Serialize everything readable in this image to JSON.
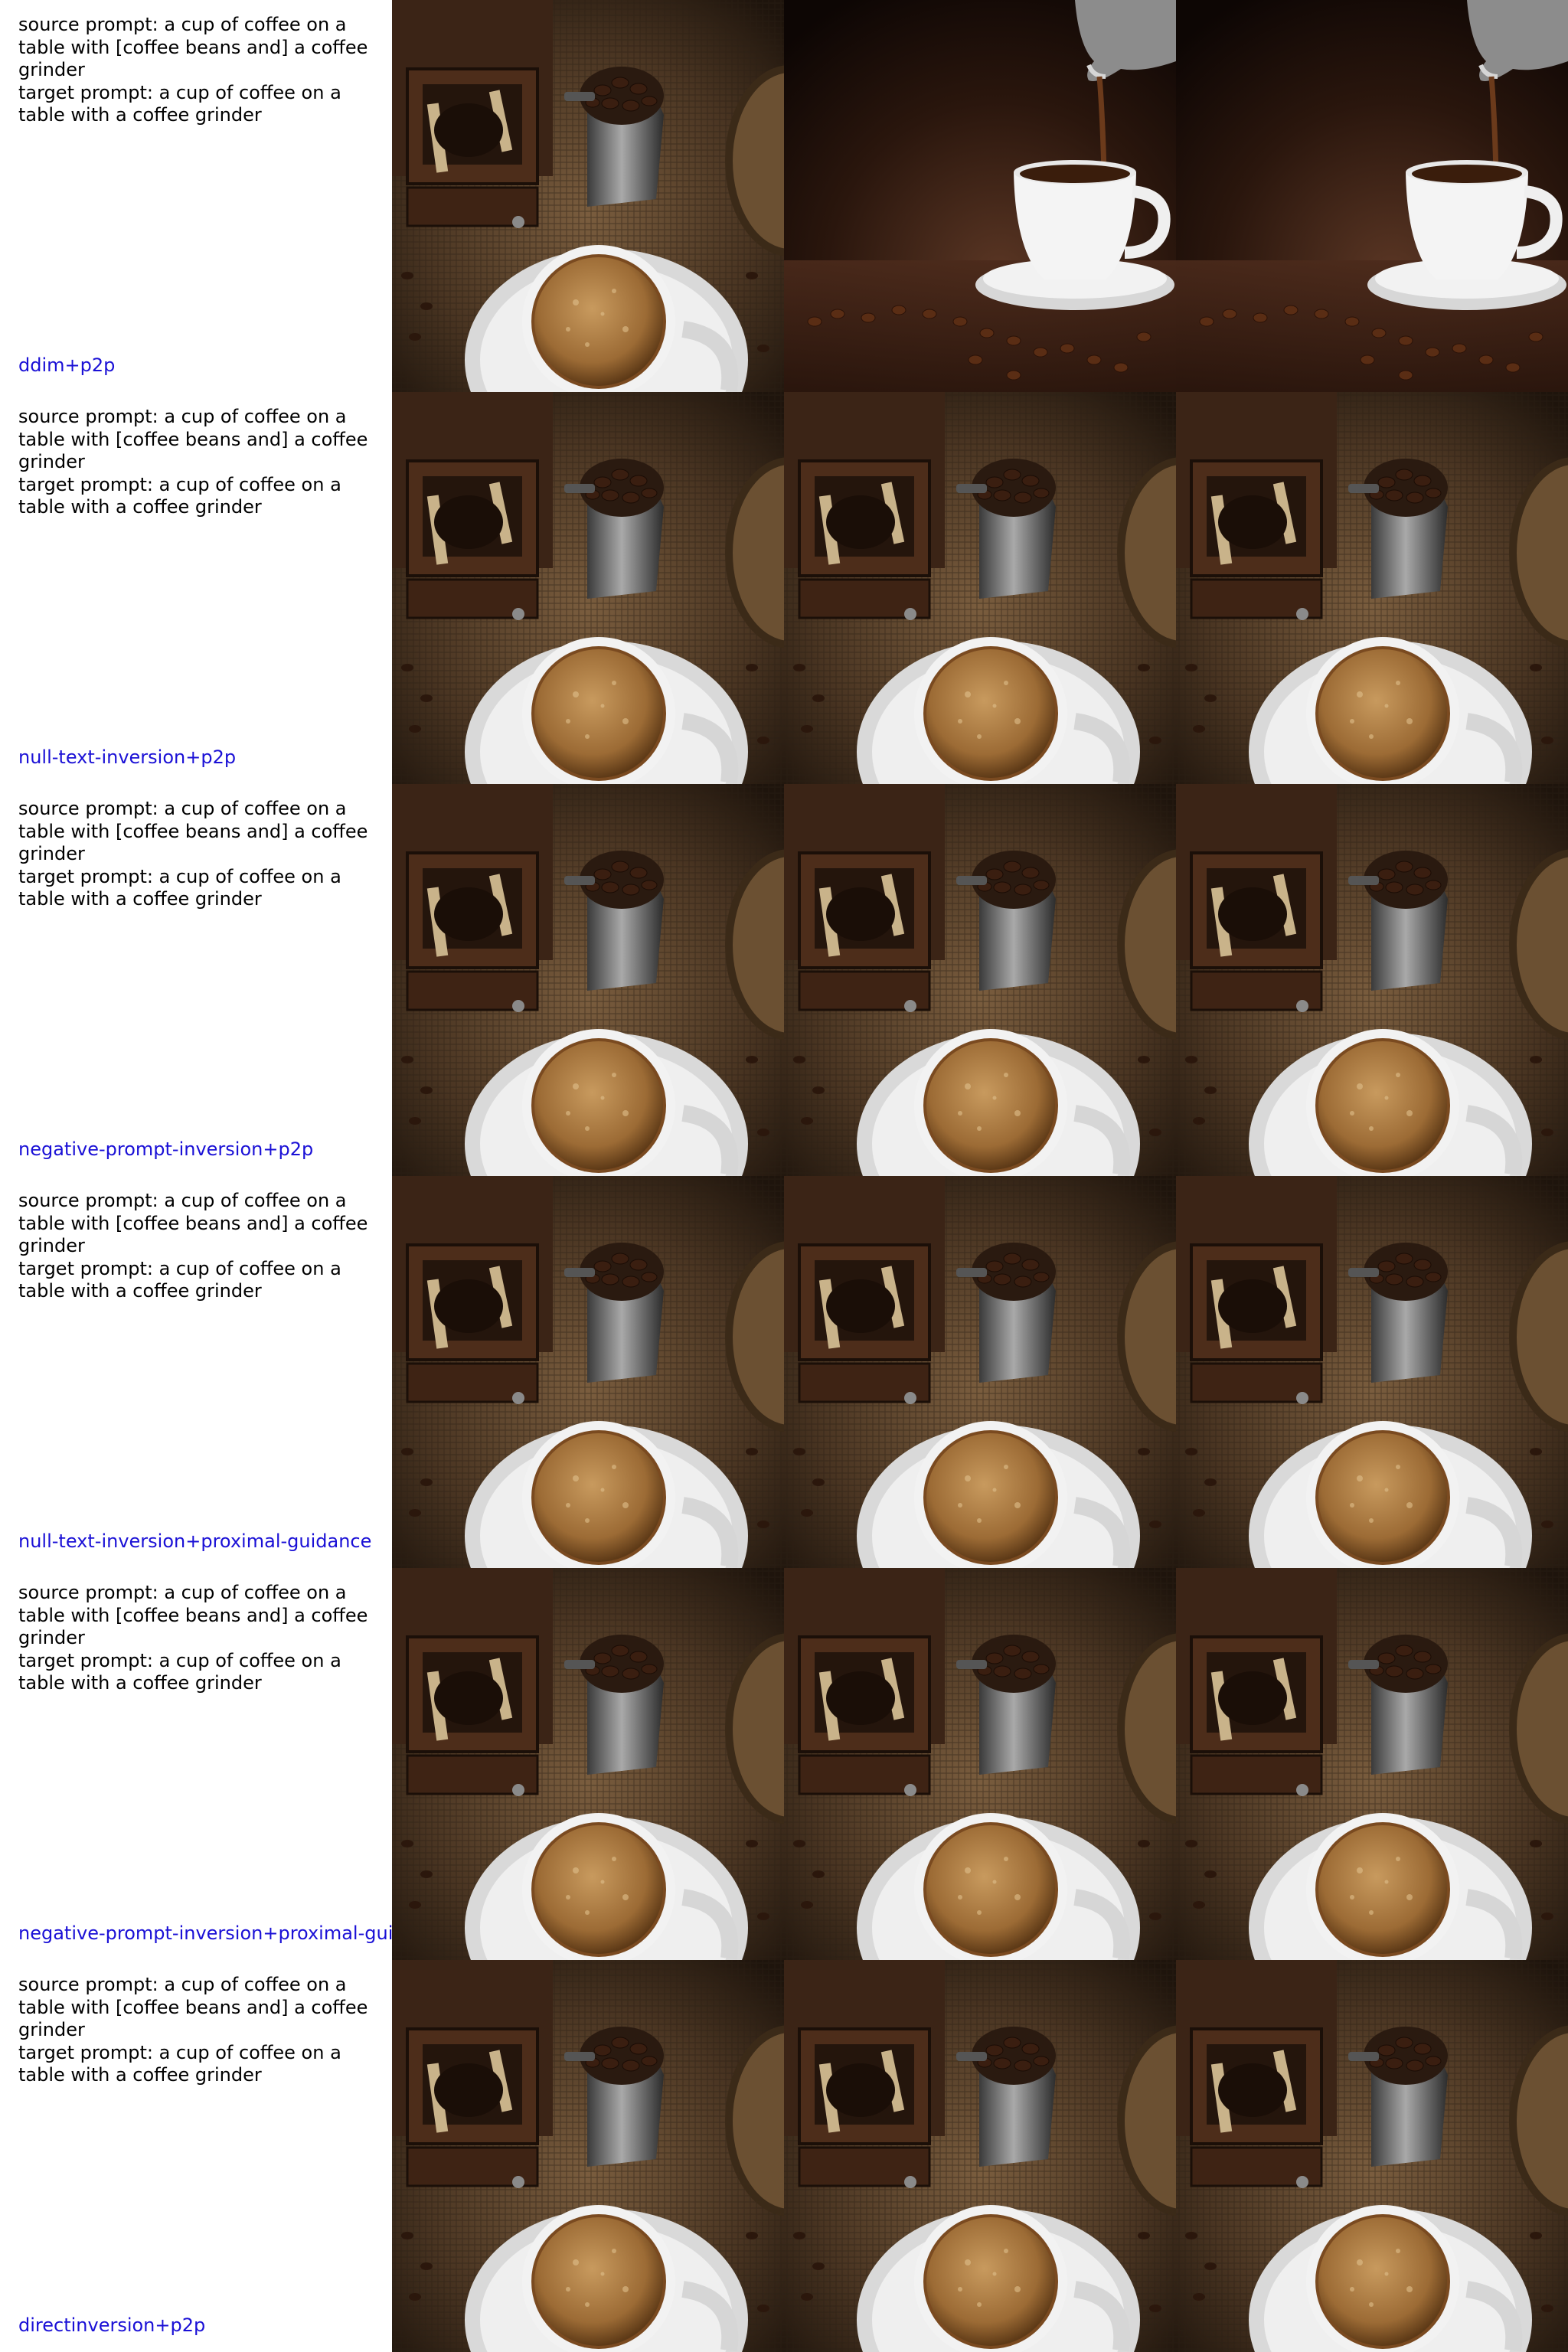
{
  "prompts": {
    "source": "source prompt: a cup of coffee on a table with [coffee beans and] a coffee grinder",
    "target": "target prompt: a cup of coffee on a table with a coffee grinder"
  },
  "rows": [
    {
      "method": "ddim+p2p",
      "images": [
        "coffee-grinder-scene",
        "coffee-pouring-scene",
        "coffee-pouring-scene"
      ]
    },
    {
      "method": "null-text-inversion+p2p",
      "images": [
        "coffee-grinder-scene",
        "coffee-grinder-scene",
        "coffee-grinder-scene"
      ]
    },
    {
      "method": "negative-prompt-inversion+p2p",
      "images": [
        "coffee-grinder-scene",
        "coffee-grinder-scene",
        "coffee-grinder-scene"
      ]
    },
    {
      "method": "null-text-inversion+proximal-guidance",
      "images": [
        "coffee-grinder-scene",
        "coffee-grinder-scene",
        "coffee-grinder-scene"
      ]
    },
    {
      "method": "negative-prompt-inversion+proximal-guidance",
      "images": [
        "coffee-grinder-scene",
        "coffee-grinder-scene",
        "coffee-grinder-scene"
      ]
    },
    {
      "method": "directinversion+p2p",
      "images": [
        "coffee-grinder-scene",
        "coffee-grinder-scene",
        "coffee-grinder-scene"
      ]
    }
  ]
}
